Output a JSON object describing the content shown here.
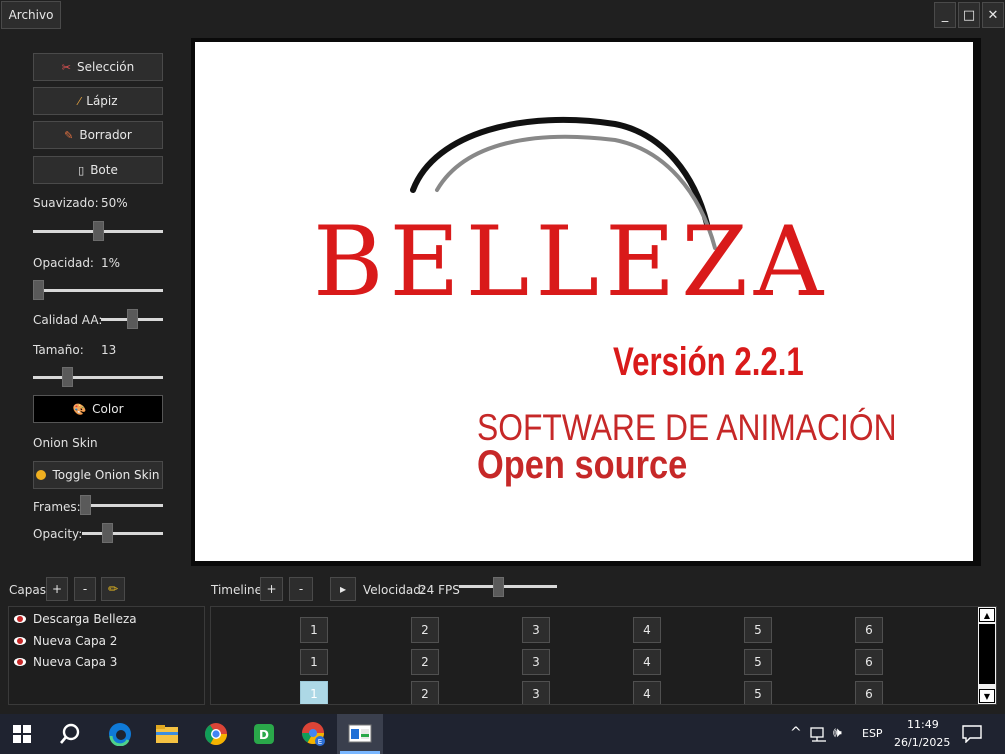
{
  "menu": {
    "archivo": "Archivo"
  },
  "window_controls": {
    "minimize": "_",
    "maximize": "□",
    "close": "✕"
  },
  "tools": {
    "seleccion": {
      "icon": "✂",
      "label": "Selección"
    },
    "lapiz": {
      "icon": "⁄",
      "label": "Lápiz"
    },
    "borrador": {
      "icon": "✎",
      "label": "Borrador"
    },
    "bote": {
      "icon": "▯",
      "label": "Bote"
    }
  },
  "brush": {
    "suavizado_label": "Suavizado:",
    "suavizado_value": "50%",
    "suavizado_fraction": 0.5,
    "opacidad_label": "Opacidad:",
    "opacidad_value": "1%",
    "opacidad_fraction": 0.01,
    "calidad_label": "Calidad AA:",
    "calidad_fraction": 0.5,
    "tamano_label": "Tamaño:",
    "tamano_value": "13",
    "tamano_fraction": 0.2,
    "color_label": "Color",
    "color_icon": "🎨"
  },
  "onion": {
    "title": "Onion Skin",
    "toggle_label": "Toggle Onion Skin",
    "frames_label": "Frames:",
    "frames_fraction": 0.0,
    "opacity_label": "Opacity:",
    "opacity_fraction": 0.3
  },
  "canvas": {
    "logo_text": "BELLEZA",
    "version": "Versión 2.2.1",
    "tagline": "SOFTWARE DE ANIMACIÓN",
    "tagline2": "Open source",
    "logo_color": "#d91a1a",
    "tagline_color": "#c62828"
  },
  "layers": {
    "title": "Capas",
    "add": "+",
    "remove": "-",
    "edit_icon": "✏",
    "items": [
      {
        "name": "Descarga Belleza"
      },
      {
        "name": "Nueva Capa 2"
      },
      {
        "name": "Nueva Capa 3"
      }
    ]
  },
  "timeline": {
    "title": "Timeline",
    "add": "+",
    "remove": "-",
    "play": "▸",
    "speed_label": "Velocidad:",
    "speed_value": "24 FPS",
    "speed_fraction": 0.4,
    "frames": [
      "1",
      "2",
      "3",
      "4",
      "5",
      "6"
    ],
    "active_row": 2,
    "active_frame": 0
  },
  "taskbar": {
    "tray_lang": "ESP",
    "time": "11:49",
    "date": "26/1/2025",
    "chevron": "^"
  }
}
